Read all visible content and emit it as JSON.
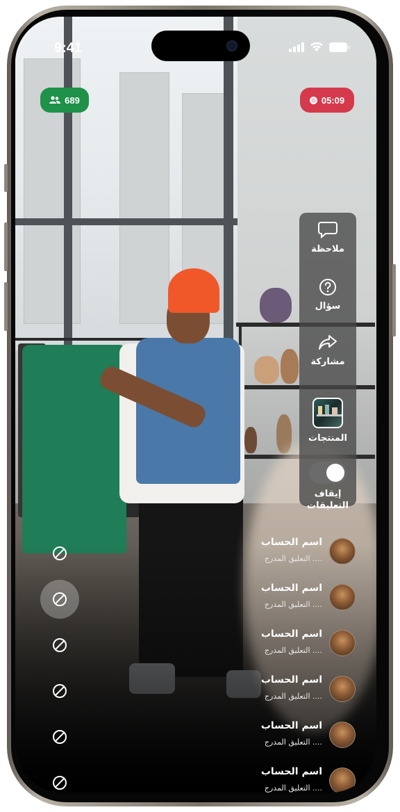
{
  "status_bar": {
    "time": "9:41"
  },
  "live": {
    "viewer_count": "689",
    "duration": "05:09",
    "colors": {
      "viewers_badge": "#1f9148",
      "timer_badge": "#d43a4c"
    }
  },
  "actions": [
    {
      "label": "ملاحظة",
      "icon": "chat-bubble-icon"
    },
    {
      "label": "سؤال",
      "icon": "question-circle-icon"
    },
    {
      "label": "مشاركة",
      "icon": "share-arrow-icon"
    },
    {
      "label": "المنتجات",
      "icon": "product-thumbnail"
    },
    {
      "label": "إيقاف التعليقات",
      "icon": "toggle-switch",
      "toggle_on": true
    }
  ],
  "comments": [
    {
      "name": "اسم الحساب",
      "text": "التعليق المدرج ...."
    },
    {
      "name": "اسم الحساب",
      "text": "التعليق المدرج ...."
    },
    {
      "name": "اسم الحساب",
      "text": "التعليق المدرج ...."
    },
    {
      "name": "اسم الحساب",
      "text": "التعليق المدرج ...."
    },
    {
      "name": "اسم الحساب",
      "text": "التعليق المدرج ...."
    },
    {
      "name": "اسم الحساب",
      "text": "التعليق المدرج ...."
    }
  ],
  "block_buttons": [
    {
      "icon": "block-icon",
      "active": false
    },
    {
      "icon": "block-icon",
      "active": true
    },
    {
      "icon": "block-icon",
      "active": false
    },
    {
      "icon": "block-icon",
      "active": false
    },
    {
      "icon": "block-icon",
      "active": false
    },
    {
      "icon": "block-icon",
      "active": false
    }
  ]
}
